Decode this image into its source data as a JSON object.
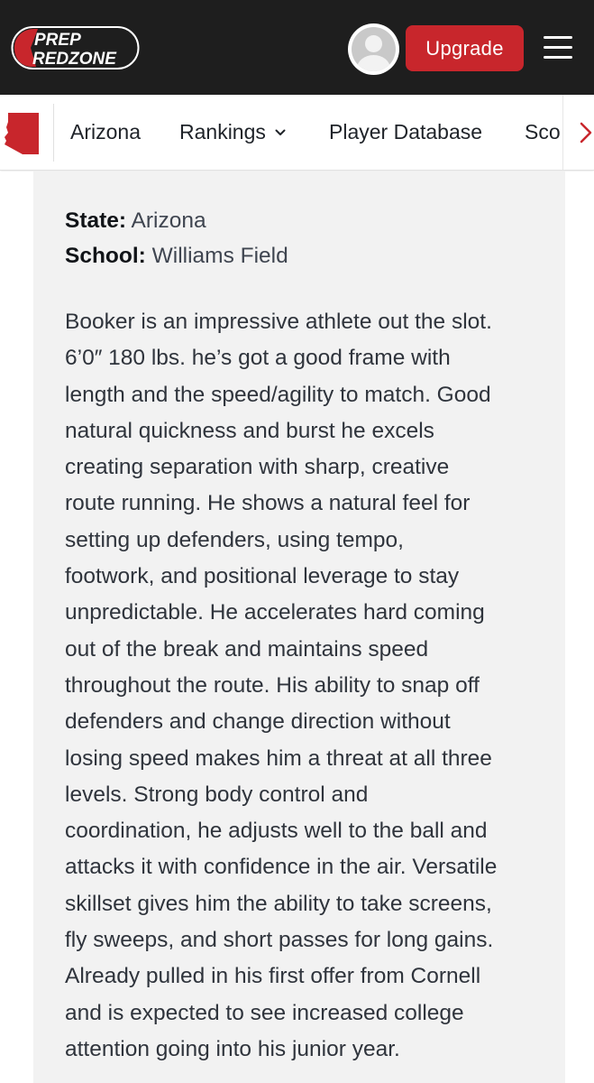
{
  "brand": {
    "logo_line1": "PREP",
    "logo_line2": "REDZONE",
    "accent": "#c8262c",
    "header_bg": "#1e1e1e"
  },
  "header": {
    "avatar_icon": "user-avatar-icon",
    "upgrade_label": "Upgrade",
    "menu_icon": "hamburger-menu-icon"
  },
  "nav": {
    "state_icon": "arizona-state-icon",
    "items": [
      {
        "label": "Arizona"
      },
      {
        "label": "Rankings",
        "has_dropdown": true
      },
      {
        "label": "Player Database"
      },
      {
        "label": "Sco"
      }
    ],
    "scroll_icon": "chevron-right-icon"
  },
  "profile": {
    "state_label": "State:",
    "state_value": "Arizona",
    "school_label": "School:",
    "school_value": "Williams Field",
    "bio_lines": [
      "Booker is an impressive athlete out the slot.",
      "6’0″ 180 lbs. he’s got a good frame with",
      "length and the speed/agility to match. Good",
      "natural quickness and burst he excels",
      "creating separation with sharp, creative",
      "route running. He shows a natural feel for",
      "setting up defenders, using tempo,",
      "footwork, and positional leverage to stay",
      "unpredictable. He accelerates hard coming",
      "out of the break and maintains speed",
      "throughout the route. His ability to snap off",
      "defenders and change direction without",
      "losing speed makes him a threat at all three",
      "levels. Strong body control and",
      "coordination, he adjusts well to the ball and",
      "attacks it with confidence in the air. Versatile",
      "skillset gives him the ability to take screens,",
      "fly sweeps, and short passes for long gains.",
      "Already pulled in his first offer from Cornell",
      "and is expected to see increased college",
      "attention going into his junior year."
    ]
  }
}
